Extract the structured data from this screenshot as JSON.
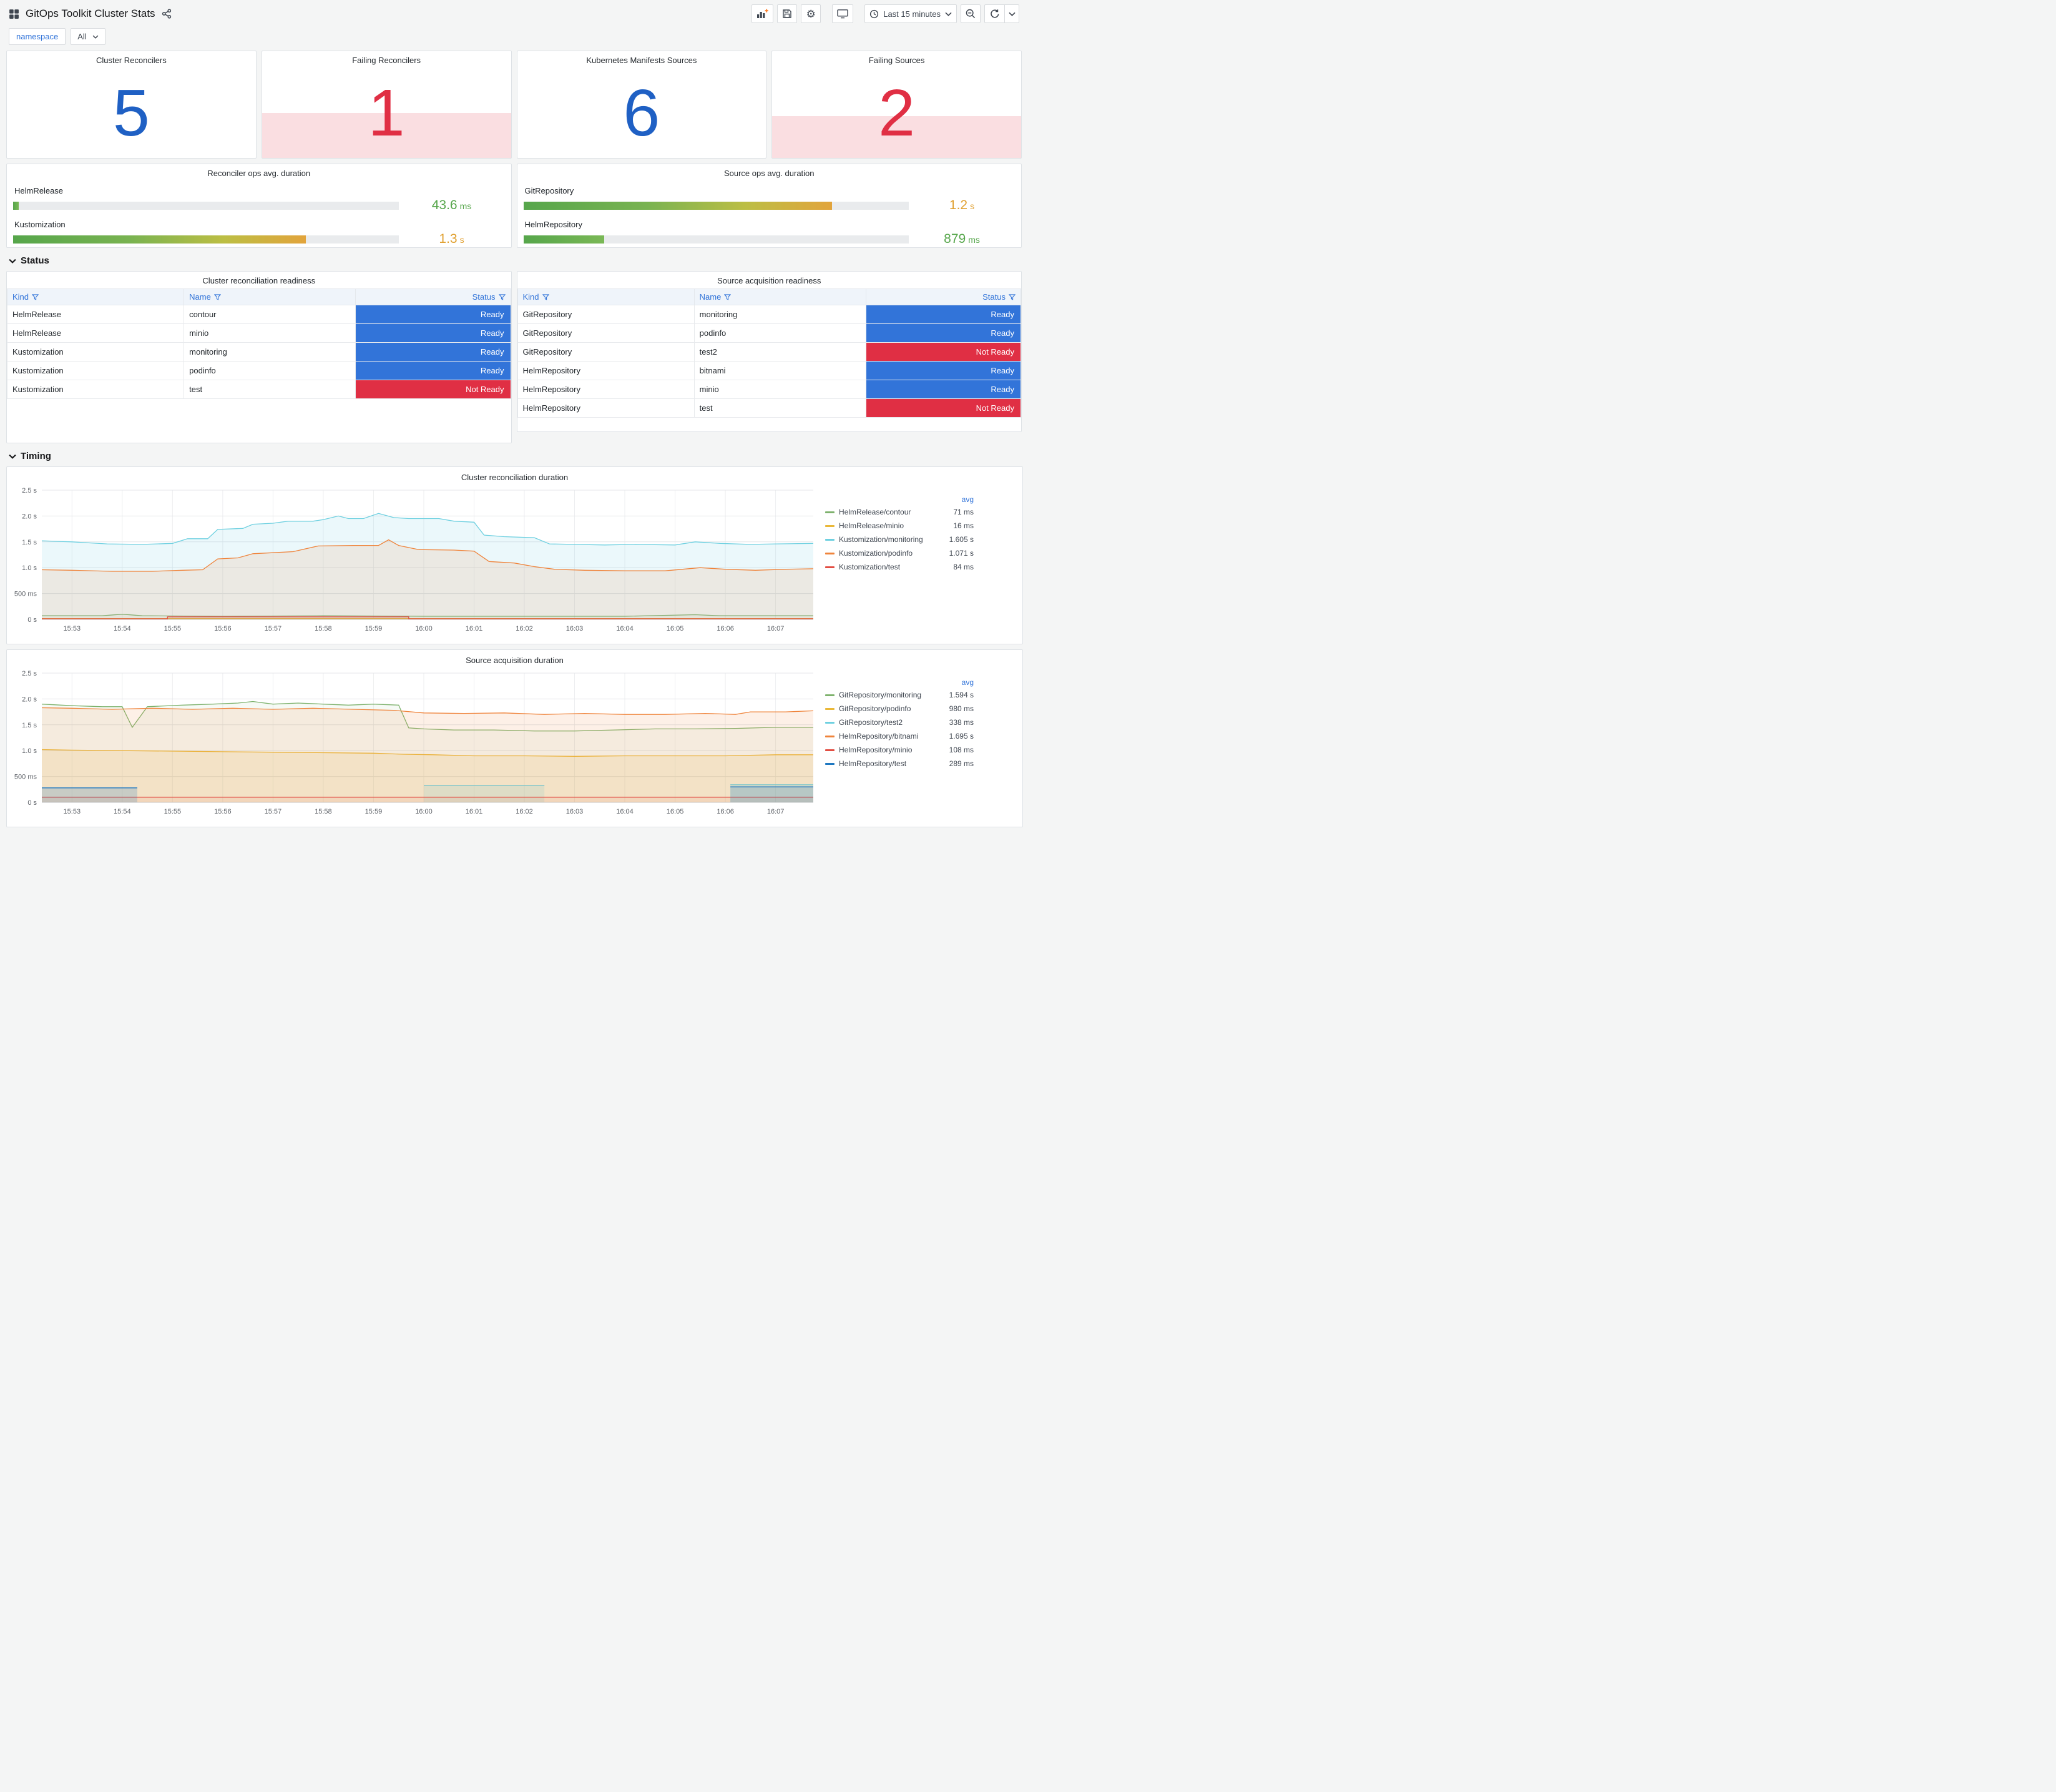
{
  "header": {
    "title": "GitOps Toolkit Cluster Stats",
    "time_range": "Last 15 minutes"
  },
  "variables": {
    "name": "namespace",
    "value": "All"
  },
  "sections": {
    "status": "Status",
    "timing": "Timing"
  },
  "colors": {
    "link_blue": "#3274D9",
    "stat_blue": "#1F60C4",
    "stat_red": "#E02F44",
    "value_green": "#56A64B",
    "value_amber": "#E0A030"
  },
  "stat_panels": [
    {
      "title": "Cluster Reconcilers",
      "value": "5",
      "color": "#1F60C4",
      "fill_pct": 0
    },
    {
      "title": "Failing Reconcilers",
      "value": "1",
      "color": "#E02F44",
      "fill_pct": 42
    },
    {
      "title": "Kubernetes Manifests Sources",
      "value": "6",
      "color": "#1F60C4",
      "fill_pct": 0
    },
    {
      "title": "Failing Sources",
      "value": "2",
      "color": "#E02F44",
      "fill_pct": 39
    }
  ],
  "gauge_panels": [
    {
      "title": "Reconciler ops avg. duration",
      "rows": [
        {
          "label": "HelmRelease",
          "value": "43.6",
          "unit": "ms",
          "pct": 1.5,
          "value_color": "#56A64B",
          "bar_style": "green"
        },
        {
          "label": "Kustomization",
          "value": "1.3",
          "unit": "s",
          "pct": 76,
          "value_color": "#E0A030",
          "bar_style": "gradient"
        }
      ]
    },
    {
      "title": "Source ops avg. duration",
      "rows": [
        {
          "label": "GitRepository",
          "value": "1.2",
          "unit": "s",
          "pct": 80,
          "value_color": "#E0A030",
          "bar_style": "gradient"
        },
        {
          "label": "HelmRepository",
          "value": "879",
          "unit": "ms",
          "pct": 21,
          "value_color": "#56A64B",
          "bar_style": "green"
        }
      ]
    }
  ],
  "table_panels": [
    {
      "title": "Cluster reconciliation readiness",
      "columns": [
        "Kind",
        "Name",
        "Status"
      ],
      "rows": [
        [
          "HelmRelease",
          "contour",
          "Ready"
        ],
        [
          "HelmRelease",
          "minio",
          "Ready"
        ],
        [
          "Kustomization",
          "monitoring",
          "Ready"
        ],
        [
          "Kustomization",
          "podinfo",
          "Ready"
        ],
        [
          "Kustomization",
          "test",
          "Not Ready"
        ]
      ]
    },
    {
      "title": "Source acquisition readiness",
      "columns": [
        "Kind",
        "Name",
        "Status"
      ],
      "rows": [
        [
          "GitRepository",
          "monitoring",
          "Ready"
        ],
        [
          "GitRepository",
          "podinfo",
          "Ready"
        ],
        [
          "GitRepository",
          "test2",
          "Not Ready"
        ],
        [
          "HelmRepository",
          "bitnami",
          "Ready"
        ],
        [
          "HelmRepository",
          "minio",
          "Ready"
        ],
        [
          "HelmRepository",
          "test",
          "Not Ready"
        ]
      ]
    }
  ],
  "status_colors": {
    "Ready": "#3274D9",
    "Not Ready": "#E02F44"
  },
  "chart_data": [
    {
      "type": "line",
      "title": "Cluster reconciliation duration",
      "legend_header": "avg",
      "x_labels": [
        "15:53",
        "15:54",
        "15:55",
        "15:56",
        "15:57",
        "15:58",
        "15:59",
        "16:00",
        "16:01",
        "16:02",
        "16:03",
        "16:04",
        "16:05",
        "16:06",
        "16:07"
      ],
      "x_range": [
        -0.6,
        14.75
      ],
      "y_max": 2.5,
      "y_ticks": [
        {
          "v": 0,
          "label": "0 s"
        },
        {
          "v": 0.5,
          "label": "500 ms"
        },
        {
          "v": 1,
          "label": "1.0 s"
        },
        {
          "v": 1.5,
          "label": "1.5 s"
        },
        {
          "v": 2,
          "label": "2.0 s"
        },
        {
          "v": 2.5,
          "label": "2.5 s"
        }
      ],
      "series": [
        {
          "name": "HelmRelease/contour",
          "color": "#7EB26D",
          "avg": "71 ms",
          "fill_opacity": 0.07,
          "segments": [
            [
              [
                -0.6,
                0.07
              ],
              [
                0.6,
                0.07
              ],
              [
                1,
                0.1
              ],
              [
                1.4,
                0.07
              ],
              [
                3,
                0.06
              ],
              [
                5,
                0.07
              ],
              [
                7,
                0.06
              ],
              [
                9,
                0.06
              ],
              [
                11,
                0.06
              ],
              [
                12.4,
                0.09
              ],
              [
                12.9,
                0.07
              ],
              [
                14.75,
                0.07
              ]
            ]
          ]
        },
        {
          "name": "HelmRelease/minio",
          "color": "#EAB839",
          "avg": "16 ms",
          "fill_opacity": 0.07,
          "segments": [
            [
              [
                -0.6,
                0.016
              ],
              [
                14.75,
                0.016
              ]
            ]
          ]
        },
        {
          "name": "Kustomization/monitoring",
          "color": "#6ED0E0",
          "avg": "1.605 s",
          "fill_opacity": 0.14,
          "segments": [
            [
              [
                -0.6,
                1.52
              ],
              [
                0,
                1.5
              ],
              [
                0.7,
                1.46
              ],
              [
                1.4,
                1.45
              ],
              [
                2,
                1.47
              ],
              [
                2.3,
                1.56
              ],
              [
                2.7,
                1.56
              ],
              [
                2.9,
                1.74
              ],
              [
                3.4,
                1.76
              ],
              [
                3.6,
                1.84
              ],
              [
                4,
                1.86
              ],
              [
                4.3,
                1.9
              ],
              [
                4.8,
                1.9
              ],
              [
                5,
                1.93
              ],
              [
                5.3,
                2.0
              ],
              [
                5.5,
                1.95
              ],
              [
                5.8,
                1.95
              ],
              [
                6.1,
                2.05
              ],
              [
                6.4,
                1.97
              ],
              [
                6.7,
                1.95
              ],
              [
                7.3,
                1.95
              ],
              [
                7.6,
                1.9
              ],
              [
                8,
                1.88
              ],
              [
                8.2,
                1.63
              ],
              [
                8.6,
                1.6
              ],
              [
                9.2,
                1.58
              ],
              [
                9.5,
                1.46
              ],
              [
                10,
                1.45
              ],
              [
                10.6,
                1.44
              ],
              [
                11.2,
                1.45
              ],
              [
                12,
                1.44
              ],
              [
                12.4,
                1.5
              ],
              [
                12.9,
                1.47
              ],
              [
                13.5,
                1.45
              ],
              [
                14,
                1.46
              ],
              [
                14.75,
                1.47
              ]
            ]
          ]
        },
        {
          "name": "Kustomization/podinfo",
          "color": "#EF843C",
          "avg": "1.071 s",
          "fill_opacity": 0.12,
          "segments": [
            [
              [
                -0.6,
                0.96
              ],
              [
                0,
                0.95
              ],
              [
                0.8,
                0.93
              ],
              [
                1.6,
                0.93
              ],
              [
                2.2,
                0.95
              ],
              [
                2.6,
                0.96
              ],
              [
                2.9,
                1.17
              ],
              [
                3.3,
                1.19
              ],
              [
                3.6,
                1.27
              ],
              [
                4,
                1.29
              ],
              [
                4.4,
                1.31
              ],
              [
                4.9,
                1.42
              ],
              [
                5.6,
                1.43
              ],
              [
                6.1,
                1.43
              ],
              [
                6.3,
                1.54
              ],
              [
                6.5,
                1.43
              ],
              [
                6.9,
                1.35
              ],
              [
                7.6,
                1.34
              ],
              [
                8,
                1.32
              ],
              [
                8.3,
                1.12
              ],
              [
                8.8,
                1.09
              ],
              [
                9.2,
                1.02
              ],
              [
                9.6,
                0.97
              ],
              [
                10.2,
                0.95
              ],
              [
                11,
                0.94
              ],
              [
                11.8,
                0.94
              ],
              [
                12.5,
                1.0
              ],
              [
                13,
                0.97
              ],
              [
                13.6,
                0.95
              ],
              [
                14.2,
                0.97
              ],
              [
                14.75,
                0.98
              ]
            ]
          ]
        },
        {
          "name": "Kustomization/test",
          "color": "#E24D42",
          "avg": "84 ms",
          "fill_opacity": 0.1,
          "segments": [
            [
              [
                -0.6,
                0.012
              ],
              [
                1.9,
                0.012
              ],
              [
                1.9,
                0.05
              ],
              [
                6.7,
                0.05
              ],
              [
                6.7,
                0.012
              ],
              [
                14.75,
                0.012
              ]
            ]
          ]
        }
      ]
    },
    {
      "type": "line",
      "title": "Source acquisition duration",
      "legend_header": "avg",
      "x_labels": [
        "15:53",
        "15:54",
        "15:55",
        "15:56",
        "15:57",
        "15:58",
        "15:59",
        "16:00",
        "16:01",
        "16:02",
        "16:03",
        "16:04",
        "16:05",
        "16:06",
        "16:07"
      ],
      "x_range": [
        -0.6,
        14.75
      ],
      "y_max": 2.5,
      "y_ticks": [
        {
          "v": 0,
          "label": "0 s"
        },
        {
          "v": 0.5,
          "label": "500 ms"
        },
        {
          "v": 1,
          "label": "1.0 s"
        },
        {
          "v": 1.5,
          "label": "1.5 s"
        },
        {
          "v": 2,
          "label": "2.0 s"
        },
        {
          "v": 2.5,
          "label": "2.5 s"
        }
      ],
      "series": [
        {
          "name": "GitRepository/monitoring",
          "color": "#7EB26D",
          "avg": "1.594 s",
          "fill_opacity": 0.07,
          "segments": [
            [
              [
                -0.6,
                1.9
              ],
              [
                0,
                1.87
              ],
              [
                0.6,
                1.85
              ],
              [
                1,
                1.85
              ],
              [
                1.2,
                1.45
              ],
              [
                1.5,
                1.85
              ],
              [
                2.2,
                1.88
              ],
              [
                2.8,
                1.9
              ],
              [
                3.3,
                1.92
              ],
              [
                3.6,
                1.95
              ],
              [
                4,
                1.9
              ],
              [
                4.5,
                1.92
              ],
              [
                5,
                1.9
              ],
              [
                5.5,
                1.88
              ],
              [
                6,
                1.9
              ],
              [
                6.5,
                1.88
              ],
              [
                6.7,
                1.44
              ],
              [
                7,
                1.42
              ],
              [
                7.6,
                1.4
              ],
              [
                8.4,
                1.4
              ],
              [
                9.2,
                1.38
              ],
              [
                10,
                1.38
              ],
              [
                10.8,
                1.4
              ],
              [
                11.6,
                1.42
              ],
              [
                12.4,
                1.42
              ],
              [
                13.2,
                1.43
              ],
              [
                14,
                1.45
              ],
              [
                14.75,
                1.45
              ]
            ]
          ]
        },
        {
          "name": "GitRepository/podinfo",
          "color": "#EAB839",
          "avg": "980 ms",
          "fill_opacity": 0.14,
          "segments": [
            [
              [
                -0.6,
                1.02
              ],
              [
                0,
                1.01
              ],
              [
                1,
                1.0
              ],
              [
                2,
                0.99
              ],
              [
                3,
                0.98
              ],
              [
                4,
                0.97
              ],
              [
                5,
                0.96
              ],
              [
                6,
                0.95
              ],
              [
                6.6,
                0.93
              ],
              [
                7.2,
                0.92
              ],
              [
                8,
                0.9
              ],
              [
                9,
                0.9
              ],
              [
                10,
                0.89
              ],
              [
                11,
                0.9
              ],
              [
                12,
                0.9
              ],
              [
                13,
                0.9
              ],
              [
                14,
                0.92
              ],
              [
                14.75,
                0.92
              ]
            ]
          ]
        },
        {
          "name": "GitRepository/test2",
          "color": "#6ED0E0",
          "avg": "338 ms",
          "fill_opacity": 0.18,
          "segments": [
            [
              [
                7,
                0.33
              ],
              [
                9.4,
                0.33
              ]
            ],
            [
              [
                13.1,
                0.34
              ],
              [
                14.75,
                0.34
              ]
            ]
          ]
        },
        {
          "name": "HelmRepository/bitnami",
          "color": "#EF843C",
          "avg": "1.695 s",
          "fill_opacity": 0.12,
          "segments": [
            [
              [
                -0.6,
                1.83
              ],
              [
                0,
                1.82
              ],
              [
                0.8,
                1.8
              ],
              [
                1.6,
                1.82
              ],
              [
                2.4,
                1.8
              ],
              [
                3.2,
                1.82
              ],
              [
                4,
                1.8
              ],
              [
                4.8,
                1.82
              ],
              [
                5.6,
                1.8
              ],
              [
                6.4,
                1.78
              ],
              [
                7,
                1.73
              ],
              [
                7.8,
                1.72
              ],
              [
                8.6,
                1.73
              ],
              [
                9.4,
                1.7
              ],
              [
                10.2,
                1.72
              ],
              [
                11,
                1.7
              ],
              [
                11.8,
                1.7
              ],
              [
                12.6,
                1.72
              ],
              [
                13.2,
                1.7
              ],
              [
                13.5,
                1.75
              ],
              [
                14.2,
                1.75
              ],
              [
                14.75,
                1.77
              ]
            ]
          ]
        },
        {
          "name": "HelmRepository/minio",
          "color": "#E24D42",
          "avg": "108 ms",
          "fill_opacity": 0.08,
          "segments": [
            [
              [
                -0.6,
                0.1
              ],
              [
                14.75,
                0.1
              ]
            ]
          ]
        },
        {
          "name": "HelmRepository/test",
          "color": "#1F78C1",
          "avg": "289 ms",
          "fill_opacity": 0.2,
          "segments": [
            [
              [
                -0.6,
                0.28
              ],
              [
                1.3,
                0.28
              ]
            ],
            [
              [
                13.1,
                0.3
              ],
              [
                14.75,
                0.3
              ]
            ]
          ]
        }
      ]
    }
  ]
}
